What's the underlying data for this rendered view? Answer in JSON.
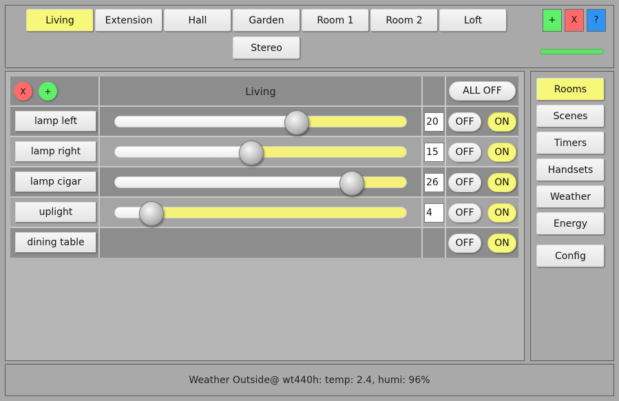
{
  "top": {
    "rooms": [
      "Living",
      "Extension",
      "Hall",
      "Garden",
      "Room 1",
      "Room 2",
      "Loft",
      "Stereo"
    ],
    "selected_room": "Living",
    "add_label": "+",
    "close_label": "X",
    "help_label": "?",
    "colors": {
      "add": "#5ff06a",
      "close": "#ff6b6b",
      "help": "#2f93f5"
    }
  },
  "room": {
    "title": "Living",
    "remove_label": "X",
    "add_label": "+",
    "all_off_label": "ALL OFF",
    "devices": [
      {
        "name": "lamp left",
        "level": 20,
        "value": "20",
        "dimmable": true,
        "off": "OFF",
        "on": "ON"
      },
      {
        "name": "lamp right",
        "level": 15,
        "value": "15",
        "dimmable": true,
        "off": "OFF",
        "on": "ON"
      },
      {
        "name": "lamp cigar",
        "level": 26,
        "value": "26",
        "dimmable": true,
        "off": "OFF",
        "on": "ON"
      },
      {
        "name": "uplight",
        "level": 4,
        "value": "4",
        "dimmable": true,
        "off": "OFF",
        "on": "ON"
      },
      {
        "name": "dining table",
        "level": null,
        "value": "",
        "dimmable": false,
        "off": "OFF",
        "on": "ON"
      }
    ],
    "slider_max": 32
  },
  "sidebar": {
    "items": [
      "Rooms",
      "Scenes",
      "Timers",
      "Handsets",
      "Weather",
      "Energy",
      "Config"
    ],
    "selected": "Rooms"
  },
  "status": {
    "text": "Weather Outside@ wt440h: temp: 2.4, humi: 96%"
  },
  "colors": {
    "accent": "#f7f77a",
    "progress": "#5fe06a"
  }
}
